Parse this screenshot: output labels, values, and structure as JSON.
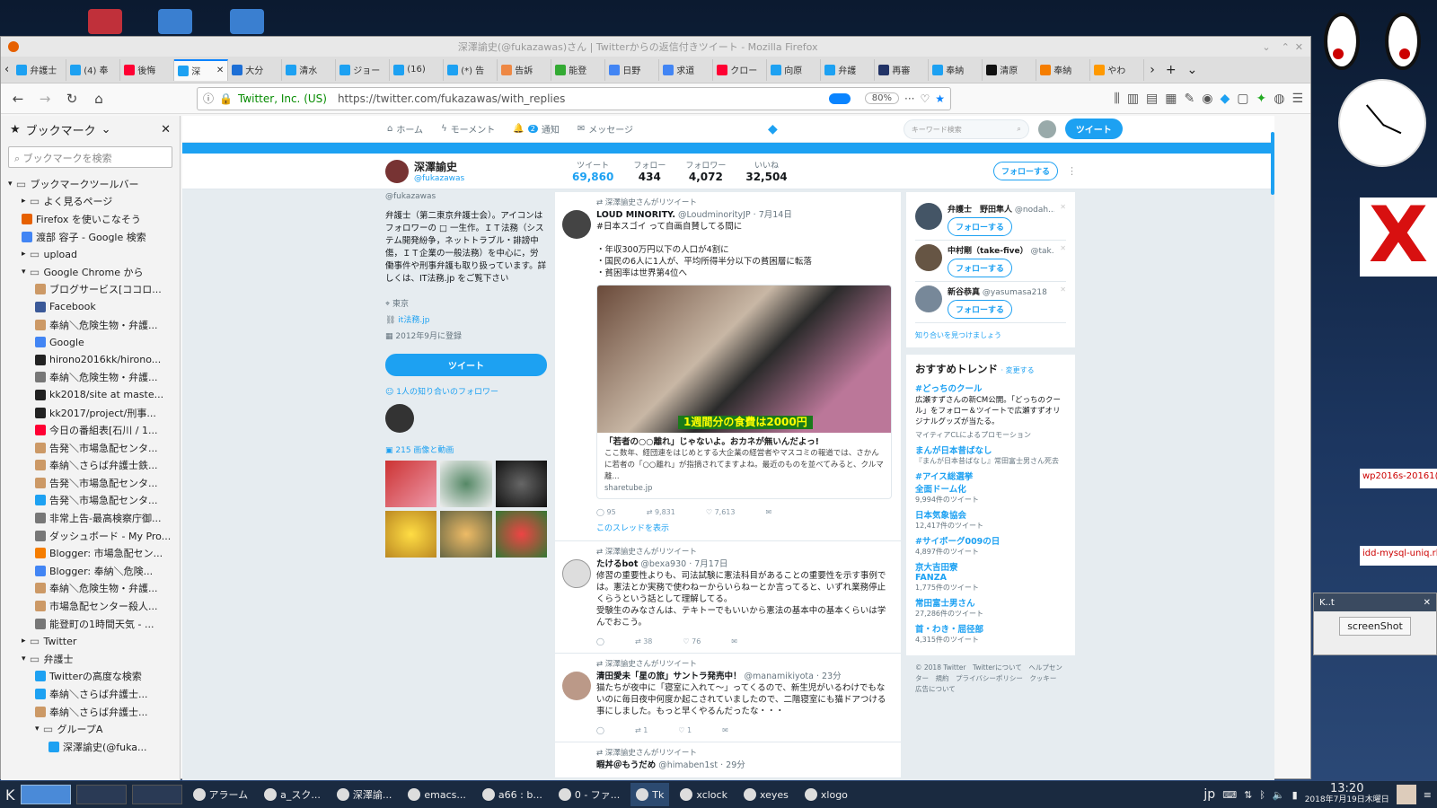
{
  "window": {
    "title": "深澤諭史(@fukazawas)さん | Twitterからの返信付きツイート - Mozilla Firefox"
  },
  "tabs": [
    {
      "label": "弁護士",
      "ic": "twitter-icon",
      "color": "#1da1f2"
    },
    {
      "label": "(4) 奉",
      "ic": "twitter-icon",
      "color": "#1da1f2"
    },
    {
      "label": "後悔",
      "ic": "yahoo-icon",
      "color": "#ff0033"
    },
    {
      "label": "深",
      "ic": "twitter-icon",
      "color": "#1da1f2",
      "active": true
    },
    {
      "label": "大分",
      "ic": "goo-icon",
      "color": "#1d6fd6"
    },
    {
      "label": "清水",
      "ic": "twitter-icon",
      "color": "#1da1f2"
    },
    {
      "label": "ジョー",
      "ic": "twitter-icon",
      "color": "#1da1f2"
    },
    {
      "label": "(16)",
      "ic": "twitter-icon",
      "color": "#1da1f2"
    },
    {
      "label": "(*) 告",
      "ic": "twitter-icon",
      "color": "#1da1f2"
    },
    {
      "label": "告訴",
      "ic": "site-icon",
      "color": "#e84"
    },
    {
      "label": "能登",
      "ic": "site-icon",
      "color": "#3a3"
    },
    {
      "label": "日野",
      "ic": "google-icon",
      "color": "#4285f4"
    },
    {
      "label": "求道",
      "ic": "google-icon",
      "color": "#4285f4"
    },
    {
      "label": "クロー",
      "ic": "yahoo-icon",
      "color": "#ff0033"
    },
    {
      "label": "向原",
      "ic": "twitter-icon",
      "color": "#1da1f2"
    },
    {
      "label": "弁護",
      "ic": "twitter-icon",
      "color": "#1da1f2"
    },
    {
      "label": "再審",
      "ic": "site-icon",
      "color": "#236"
    },
    {
      "label": "奉納",
      "ic": "site-icon",
      "color": "#1da1f2"
    },
    {
      "label": "清原",
      "ic": "site-icon",
      "color": "#111"
    },
    {
      "label": "奉納",
      "ic": "blogger-icon",
      "color": "#f57d00"
    },
    {
      "label": "やわ",
      "ic": "site-icon",
      "color": "#f90"
    }
  ],
  "nav": {
    "org": "Twitter, Inc. (US)",
    "url": "https://twitter.com/fukazawas/with_replies",
    "zoom": "80%"
  },
  "sidebar": {
    "title": "ブックマーク",
    "search_placeholder": "ブックマークを検索",
    "close": "✕",
    "items": [
      {
        "label": "ブックマークツールバー",
        "indent": 0,
        "type": "folder-open"
      },
      {
        "label": "よく見るページ",
        "indent": 1,
        "type": "folder"
      },
      {
        "label": "Firefox を使いこなそう",
        "indent": 1,
        "type": "firefox"
      },
      {
        "label": "渡部 容子 - Google 検索",
        "indent": 1,
        "type": "google"
      },
      {
        "label": "upload",
        "indent": 1,
        "type": "folder"
      },
      {
        "label": "Google Chrome から",
        "indent": 1,
        "type": "folder-open"
      },
      {
        "label": "ブログサービス[ココロ...",
        "indent": 2,
        "type": "site"
      },
      {
        "label": "Facebook",
        "indent": 2,
        "type": "facebook"
      },
      {
        "label": "奉納＼危険生物・弁護...",
        "indent": 2,
        "type": "site"
      },
      {
        "label": "Google",
        "indent": 2,
        "type": "google"
      },
      {
        "label": "hirono2016kk/hirono...",
        "indent": 2,
        "type": "github"
      },
      {
        "label": "奉納＼危険生物・弁護...",
        "indent": 2,
        "type": "globe"
      },
      {
        "label": "kk2018/site at maste...",
        "indent": 2,
        "type": "github"
      },
      {
        "label": "kk2017/project/刑事...",
        "indent": 2,
        "type": "github"
      },
      {
        "label": "今日の番組表[石川 / 1...",
        "indent": 2,
        "type": "yahoo"
      },
      {
        "label": "告発＼市場急配センタ...",
        "indent": 2,
        "type": "site"
      },
      {
        "label": "奉納＼さらば弁護士鉄...",
        "indent": 2,
        "type": "site"
      },
      {
        "label": "告発＼市場急配センタ...",
        "indent": 2,
        "type": "site"
      },
      {
        "label": "告発＼市場急配センタ...",
        "indent": 2,
        "type": "twitter"
      },
      {
        "label": "非常上告-最高検察庁御...",
        "indent": 2,
        "type": "globe"
      },
      {
        "label": "ダッシュボード - My Pro...",
        "indent": 2,
        "type": "globe"
      },
      {
        "label": "Blogger: 市場急配セン...",
        "indent": 2,
        "type": "blogger"
      },
      {
        "label": "Blogger: 奉納＼危険...",
        "indent": 2,
        "type": "google"
      },
      {
        "label": "奉納＼危険生物・弁護...",
        "indent": 2,
        "type": "site"
      },
      {
        "label": "市場急配センター殺人...",
        "indent": 2,
        "type": "site"
      },
      {
        "label": "能登町の1時間天気 - ...",
        "indent": 2,
        "type": "globe"
      },
      {
        "label": "Twitter",
        "indent": 1,
        "type": "folder"
      },
      {
        "label": "弁護士",
        "indent": 1,
        "type": "folder-open"
      },
      {
        "label": "Twitterの高度な検索",
        "indent": 2,
        "type": "twitter"
      },
      {
        "label": "奉納＼さらば弁護士...",
        "indent": 2,
        "type": "twitter"
      },
      {
        "label": "奉納＼さらば弁護士...",
        "indent": 2,
        "type": "site"
      },
      {
        "label": "グループA",
        "indent": 2,
        "type": "folder-open"
      },
      {
        "label": "深澤諭史(@fuka...",
        "indent": 3,
        "type": "twitter"
      }
    ]
  },
  "twitter": {
    "nav": {
      "home": "ホーム",
      "moments": "モーメント",
      "notif": "通知",
      "notif_count": "2",
      "messages": "メッセージ",
      "search_placeholder": "キーワード検索",
      "tweet_btn": "ツイート"
    },
    "profile": {
      "name": "深澤諭史",
      "handle": "@fukazawas",
      "follow_btn": "フォローする",
      "stats": [
        {
          "label": "ツイート",
          "value": "69,860"
        },
        {
          "label": "フォロー",
          "value": "434"
        },
        {
          "label": "フォロワー",
          "value": "4,072"
        },
        {
          "label": "いいね",
          "value": "32,504"
        }
      ],
      "bio": "弁護士（第二東京弁護士会）。アイコンはフォロワーの □ 一生作。ＩＴ法務（システム開発紛争，ネットトラブル・誹謗中傷，ＩＴ企業の一般法務）を中心に，労働事件や刑事弁護も取り扱っています。詳しくは、IT法務.jp をご覧下さい",
      "location": "東京",
      "site": "it法務.jp",
      "joined": "2012年9月に登録",
      "tweet_btn": "ツイート",
      "mutual": "1人の知り合いのフォロワー",
      "media": "215 画像と動画"
    },
    "tweets": [
      {
        "rt": "深澤諭史さんがリツイート",
        "name": "LOUD MINORITY.",
        "handle": "@LoudminorityJP · 7月14日",
        "body": "#日本スゴイ って自画自賛してる間に\n\n・年収300万円以下の人口が4割に\n・国民の6人に1人が、平均所得半分以下の貧困層に転落\n・貧困率は世界第4位へ",
        "card_caption": "1週間分の食費は2000円",
        "card_title": "「若者の○○離れ」じゃないよ。おカネが無いんだよっ!",
        "card_desc": "ここ数年、経団連をはじめとする大企業の経営者やマスコミの報道では、さかんに若者の「○○離れ」が指摘されてますよね。最近のものを並べてみると、クルマ離...",
        "card_domain": "sharetube.jp",
        "reply": "95",
        "retweet": "9,831",
        "like": "7,613",
        "thread": "このスレッドを表示"
      },
      {
        "rt": "深澤諭史さんがリツイート",
        "name": "たけるbot",
        "handle": "@bexa930 · 7月17日",
        "body": "修習の重要性よりも、司法試験に憲法科目があることの重要性を示す事例では。憲法とか実務で使わねーからいらねーとか言ってると、いずれ業務停止くらうという話として理解してる。\n受験生のみなさんは、テキトーでもいいから憲法の基本中の基本くらいは学んでおこう。",
        "reply": "",
        "retweet": "38",
        "like": "76"
      },
      {
        "rt": "深澤諭史さんがリツイート",
        "name": "清田愛未「星の旅」サントラ発売中！",
        "handle": "@manamikiyota · 23分",
        "body": "猫たちが夜中に「寝室に入れて〜」ってくるので、新生児がいるわけでもないのに毎日夜中何度か起こされていましたので、二階寝室にも猫ドアつける事にしました。もっと早くやるんだったな・・・",
        "reply": "",
        "retweet": "1",
        "like": "1"
      },
      {
        "rt": "深澤諭史さんがリツイート",
        "name": "暇丼＠もうだめ",
        "handle": "@himaben1st · 29分",
        "body": ""
      }
    ],
    "who": [
      {
        "name": "弁護士　野田隼人",
        "handle": "@nodah...",
        "btn": "フォローする"
      },
      {
        "name": "中村剛（take-five）",
        "handle": "@tak...",
        "btn": "フォローする"
      },
      {
        "name": "新谷恭真",
        "handle": "@yasumasa218",
        "btn": "フォローする"
      }
    ],
    "find_friends": "知り合いを見つけましょう",
    "trends_title": "おすすめトレンド",
    "trends_change": "· 変更する",
    "trends": [
      {
        "t": "#どっちのクール",
        "s": "広瀬すずさんの新CM公開。「どっちのクール」をフォロー＆ツイートで広瀬すずオリジナルグッズが当たる。",
        "p": "マイティアCLによるプロモーション"
      },
      {
        "t": "まんが日本昔ばなし",
        "s": "『まんが日本昔ばなし』常田富士男さん死去"
      },
      {
        "t": "#アイス総選挙",
        "s": ""
      },
      {
        "t": "全面ドーム化",
        "s": "9,994件のツイート"
      },
      {
        "t": "日本気象協会",
        "s": "12,417件のツイート"
      },
      {
        "t": "#サイボーグ009の日",
        "s": "4,897件のツイート"
      },
      {
        "t": "京大吉田寮",
        "s": ""
      },
      {
        "t": "FANZA",
        "s": "1,775件のツイート"
      },
      {
        "t": "常田富士男さん",
        "s": "27,286件のツイート"
      },
      {
        "t": "首・わき・屈径部",
        "s": "4,315件のツイート"
      }
    ],
    "footer": "© 2018 Twitter　Twitterについて　ヘルプセンター　規約　プライバシーポリシー　クッキー　広告について"
  },
  "taskbar": {
    "items": [
      "アラーム",
      "a_スク...",
      "深澤諭...",
      "emacs...",
      "a66 : b...",
      "0 - ファ...",
      "Tk",
      "xclock",
      "xeyes",
      "xlogo"
    ],
    "ime": "jp",
    "time": "13:20",
    "date": "2018年7月19日木曜日"
  },
  "kt": {
    "title": "K..t",
    "button": "screenShot"
  },
  "right_snips": [
    "wp2016s-20161(",
    "idd-mysql-uniq.rl"
  ]
}
